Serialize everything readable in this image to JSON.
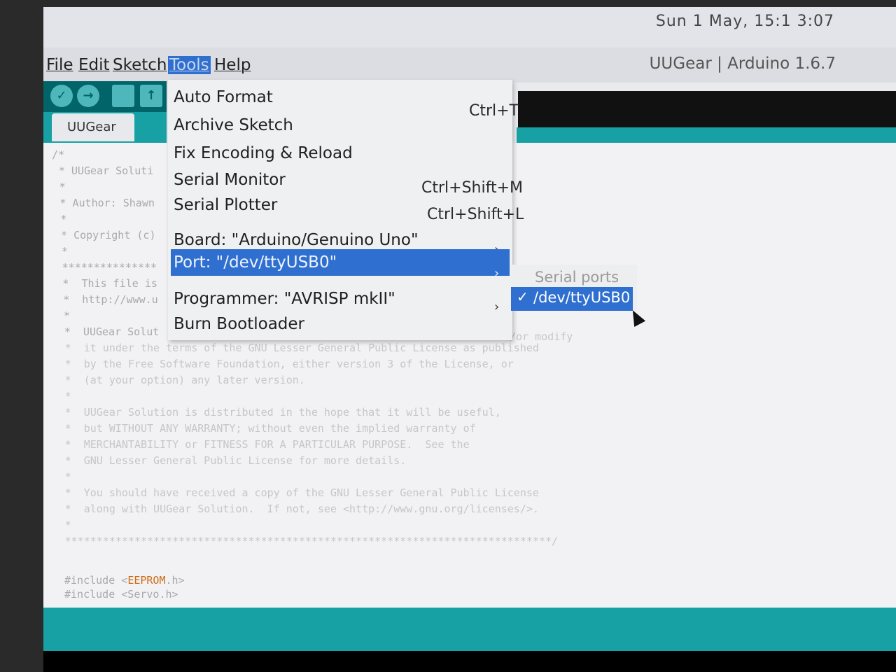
{
  "system": {
    "clock": "Sun  1 May, 15:1 3:07"
  },
  "window": {
    "title": "UUGear | Arduino 1.6.7"
  },
  "menubar": [
    "File",
    "Edit",
    "Sketch",
    "Tools",
    "Help"
  ],
  "editor": {
    "tab_label": "UUGear",
    "lines": [
      "/*",
      " * UUGear Soluti",
      " *",
      " * Author: Shawn",
      " *",
      " * Copyright (c)",
      " *",
      " ***************",
      " *  This file is",
      " *  http://www.u",
      " *",
      " *  UUGear Solut",
      " *  it under the terms of the GNU Lesser General Public License as published",
      " *  by the Free Software Foundation, either version 3 of the License, or",
      " *  (at your option) any later version.",
      " *",
      " *  UUGear Solution is distributed in the hope that it will be useful,",
      " *  but WITHOUT ANY WARRANTY; without even the implied warranty of",
      " *  MERCHANTABILITY or FITNESS FOR A PARTICULAR PURPOSE.  See the",
      " *  GNU Lesser General Public License for more details.",
      " *",
      " *  You should have received a copy of the GNU Lesser General Public License",
      " *  along with UUGear Solution.  If not, see <http://www.gnu.org/licenses/>.",
      " *",
      " *****************************************************************************/"
    ],
    "right_fragment": "/or modify",
    "include_1_prefix": "#include <",
    "include_1_lib": "EEPROM",
    "include_1_suffix": ".h>",
    "include_2": "#include <Servo.h>"
  },
  "tools_menu": {
    "items": [
      {
        "label": "Auto Format",
        "shortcut": "Ctrl+T"
      },
      {
        "label": "Archive Sketch",
        "shortcut": ""
      },
      {
        "label": "Fix Encoding & Reload",
        "shortcut": ""
      },
      {
        "label": "Serial Monitor",
        "shortcut": "Ctrl+Shift+M"
      },
      {
        "label": "Serial Plotter",
        "shortcut": "Ctrl+Shift+L"
      },
      {
        "label": "Board: \"Arduino/Genuino Uno\"",
        "arrow": "›"
      },
      {
        "label": "Port: \"/dev/ttyUSB0\"",
        "arrow": "›"
      },
      {
        "label": "Programmer: \"AVRISP mkII\"",
        "arrow": "›"
      },
      {
        "label": "Burn Bootloader",
        "shortcut": ""
      }
    ]
  },
  "port_submenu": {
    "header": "Serial ports",
    "selected": "/dev/ttyUSB0",
    "check": "✓"
  },
  "colors": {
    "accent": "#2f6fd0",
    "toolbar": "#006468",
    "teal": "#17a1a5"
  }
}
